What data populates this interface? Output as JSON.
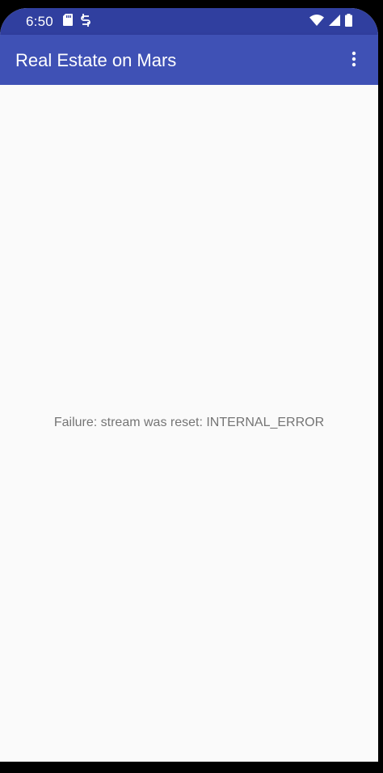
{
  "status_bar": {
    "time": "6:50",
    "left_icons": [
      "sd-card-icon",
      "sync-icon"
    ],
    "right_icons": [
      "wifi-icon",
      "cellular-signal-icon",
      "battery-icon"
    ],
    "background_color": "#303f9f"
  },
  "app_bar": {
    "title": "Real Estate on Mars",
    "overflow_icon": "more-vert-icon",
    "background_color": "#3f51b5"
  },
  "main": {
    "error_message": "Failure: stream was reset: INTERNAL_ERROR",
    "text_color": "#757575",
    "background_color": "#fafafa"
  }
}
